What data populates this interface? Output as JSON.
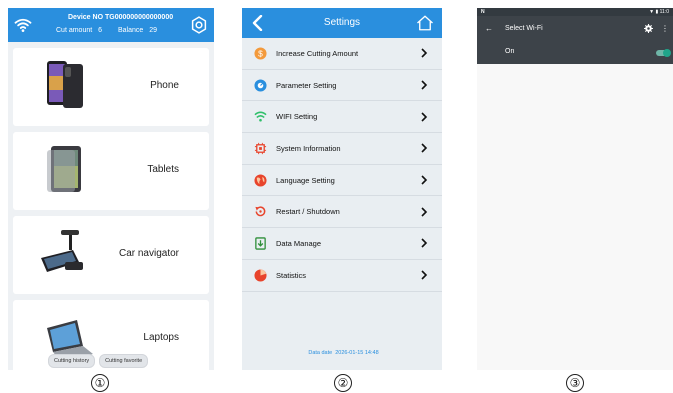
{
  "panel1": {
    "device_label": "Device NO",
    "device_no": "TG000000000000000",
    "cut_amount_label": "Cut amount",
    "cut_amount_value": "6",
    "balance_label": "Balance",
    "balance_value": "29",
    "cards": [
      {
        "label": "Phone",
        "icon": "phone-icon"
      },
      {
        "label": "Tablets",
        "icon": "tablet-icon"
      },
      {
        "label": "Car navigator",
        "icon": "car-navigator-icon"
      },
      {
        "label": "Laptops",
        "icon": "laptop-icon"
      }
    ],
    "history_button": "Cutting history",
    "favorite_button": "Cutting favorite"
  },
  "panel2": {
    "title": "Settings",
    "menu": [
      {
        "label": "Increase Cutting Amount",
        "icon": "coin-icon",
        "color": "#f39a3c"
      },
      {
        "label": "Parameter Setting",
        "icon": "dial-icon",
        "color": "#2a8fde"
      },
      {
        "label": "WIFI Setting",
        "icon": "wifi-icon",
        "color": "#2fbf6a"
      },
      {
        "label": "System Information",
        "icon": "chip-icon",
        "color": "#e8442c"
      },
      {
        "label": "Language Setting",
        "icon": "globe-icon",
        "color": "#e8442c"
      },
      {
        "label": "Restart / Shutdown",
        "icon": "restart-icon",
        "color": "#e8442c"
      },
      {
        "label": "Data Manage",
        "icon": "download-icon",
        "color": "#2f8f3a"
      },
      {
        "label": "Statistics",
        "icon": "pie-chart-icon",
        "color": "#e8442c"
      }
    ],
    "data_date_label": "Data date",
    "data_date_value": "2026-01-15 14:48"
  },
  "panel3": {
    "status_left": "N",
    "status_right": "▼ ▮ 11:0",
    "title": "Select Wi-Fi",
    "on_label": "On",
    "toggle_on": 1
  },
  "numbers": [
    "①",
    "②",
    "③"
  ],
  "colors": {
    "accent": "#2a8fde",
    "android_bar": "#3d4349",
    "toggle": "#20a58a"
  }
}
